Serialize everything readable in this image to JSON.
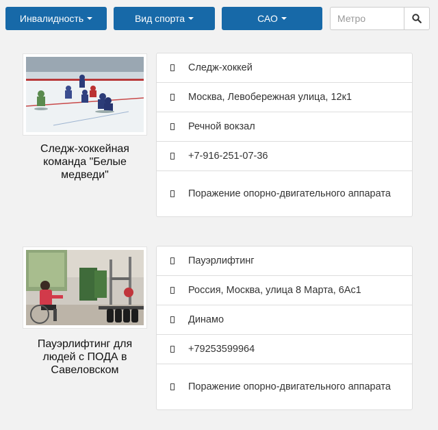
{
  "filters": {
    "disability_label": "Инвалидность",
    "sport_label": "Вид спорта",
    "district_label": "САО",
    "metro_placeholder": "Метро",
    "search_icon": "search-icon"
  },
  "cards": [
    {
      "title": "Следж-хоккейная команда \"Белые медведи\"",
      "image": "sledge-hockey-photo",
      "sport": "Следж-хоккей",
      "address": "Москва, Левобережная улица, 12к1",
      "metro": "Речной вокзал",
      "phone": "+7-916-251-07-36",
      "disability": "Поражение опорно-двигательного аппарата"
    },
    {
      "title": "Пауэрлифтинг для людей с ПОДА в Савеловском",
      "image": "powerlifting-gym-photo",
      "sport": "Пауэрлифтинг",
      "address": "Россия, Москва, улица 8 Марта, 6Ас1",
      "metro": "Динамо",
      "phone": "+79253599964",
      "disability": "Поражение опорно-двигательного аппарата"
    }
  ],
  "colors": {
    "button": "#1769a8",
    "page_bg": "#f2f2f2"
  }
}
